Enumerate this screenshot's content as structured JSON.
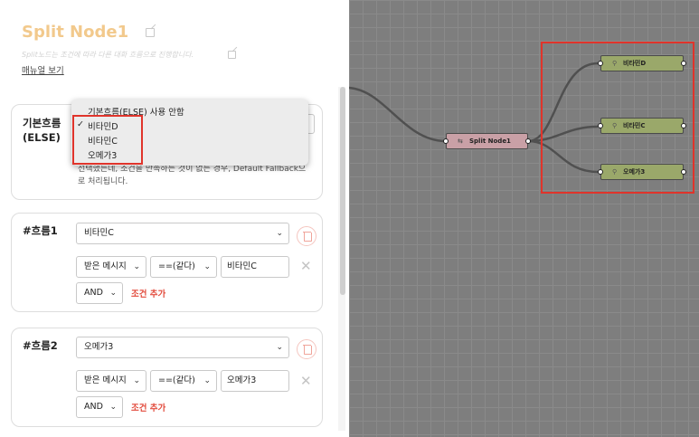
{
  "header": {
    "title": "Split Node1",
    "subtitle": "Split노드는 조건에 따라 다른 대화 흐름으로 진행합니다.",
    "manual_link": "매뉴얼 보기"
  },
  "else_card": {
    "label": "기본흐름 (ELSE)",
    "description": "선택했는데, 조건을 만족하는 것이 없는 경우, Default Fallback으로 처리됩니다."
  },
  "dropdown": {
    "items": [
      "기본흐름(ELSE) 사용 안함",
      "비타민D",
      "비타민C",
      "오메가3"
    ],
    "checked_item": "비타민D",
    "check_glyph": "✓"
  },
  "flows": [
    {
      "label": "#흐름1",
      "target": "비타민C",
      "field": "받은 메시지",
      "operator": "==(같다)",
      "value": "비타민C",
      "logic": "AND",
      "add_condition": "조건 추가"
    },
    {
      "label": "#흐름2",
      "target": "오메가3",
      "field": "받은 메시지",
      "operator": "==(같다)",
      "value": "오메가3",
      "logic": "AND",
      "add_condition": "조건 추가"
    }
  ],
  "canvas": {
    "split_node": {
      "label": "Split Node1",
      "icon": "split-icon"
    },
    "target_nodes": [
      {
        "label": "비타민D",
        "icon": "mic-icon"
      },
      {
        "label": "비타민C",
        "icon": "mic-icon"
      },
      {
        "label": "오메가3",
        "icon": "mic-icon"
      }
    ]
  },
  "colors": {
    "title": "#f2c98c",
    "accent_red": "#e24a3b",
    "highlight_box": "#e0342b",
    "split_node_fill": "#c9a0a6",
    "target_node_fill": "#9aa86a",
    "canvas_bg": "#7e7e7e"
  }
}
